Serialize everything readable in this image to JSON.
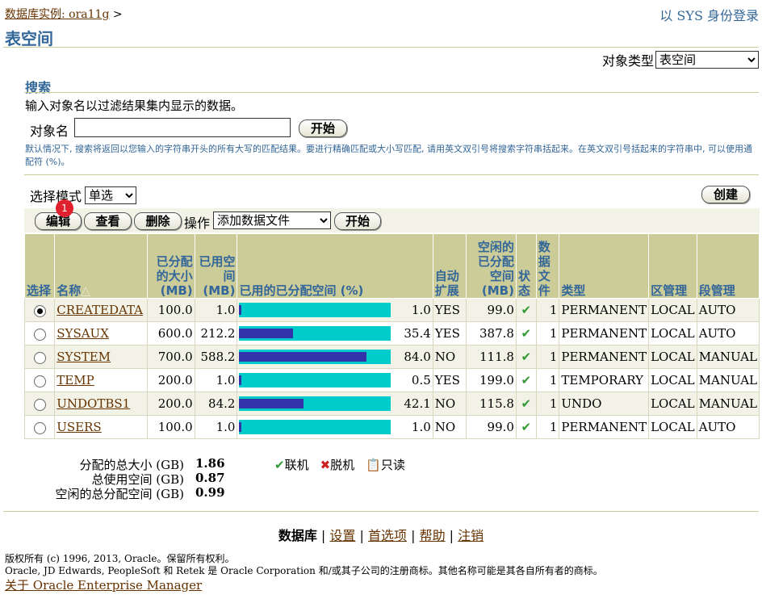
{
  "header": {
    "breadcrumb": "数据库实例: ora11g",
    "breadcrumb_sep": ">",
    "login": "以 SYS 身份登录",
    "title": "表空间"
  },
  "object_type": {
    "label": "对象类型",
    "value": "表空间"
  },
  "search": {
    "title": "搜索",
    "desc": "输入对象名以过滤结果集内显示的数据。",
    "object_label": "对象名",
    "input_value": "",
    "go": "开始",
    "hint": "默认情况下, 搜索将返回以您输入的字符串开头的所有大写的匹配结果。要进行精确匹配或大小写匹配, 请用英文双引号将搜索字符串括起来。在英文双引号括起来的字符串中, 可以使用通配符 (%)。"
  },
  "selection": {
    "label": "选择模式",
    "value": "单选",
    "create": "创建"
  },
  "actions": {
    "edit": "编辑",
    "view": "查看",
    "delete": "删除",
    "op_label": "操作",
    "op_value": "添加数据文件",
    "go": "开始",
    "badge": "1"
  },
  "columns": {
    "select": "选择",
    "name": "名称",
    "alloc_size": "已分配的大小(MB)",
    "used": "已用空间(MB)",
    "used_pct": "已用的已分配空间 (%)",
    "autoext": "自动扩展",
    "free": "空闲的已分配空间(MB)",
    "status": "状态",
    "datafiles": "数据文件",
    "type": "类型",
    "extent_mgmt": "区管理",
    "seg_mgmt": "段管理"
  },
  "rows": [
    {
      "name": "CREATEDATA",
      "size": "100.0",
      "used": "1.0",
      "pct": "1.0",
      "pct_val": 1.0,
      "auto": "YES",
      "free": "99.0",
      "files": "1",
      "type": "PERMANENT",
      "ext": "LOCAL",
      "seg": "AUTO"
    },
    {
      "name": "SYSAUX",
      "size": "600.0",
      "used": "212.2",
      "pct": "35.4",
      "pct_val": 35.4,
      "auto": "YES",
      "free": "387.8",
      "files": "1",
      "type": "PERMANENT",
      "ext": "LOCAL",
      "seg": "AUTO"
    },
    {
      "name": "SYSTEM",
      "size": "700.0",
      "used": "588.2",
      "pct": "84.0",
      "pct_val": 84.0,
      "auto": "NO",
      "free": "111.8",
      "files": "1",
      "type": "PERMANENT",
      "ext": "LOCAL",
      "seg": "MANUAL"
    },
    {
      "name": "TEMP",
      "size": "200.0",
      "used": "1.0",
      "pct": "0.5",
      "pct_val": 0.5,
      "auto": "YES",
      "free": "199.0",
      "files": "1",
      "type": "TEMPORARY",
      "ext": "LOCAL",
      "seg": "MANUAL"
    },
    {
      "name": "UNDOTBS1",
      "size": "200.0",
      "used": "84.2",
      "pct": "42.1",
      "pct_val": 42.1,
      "auto": "NO",
      "free": "115.8",
      "files": "1",
      "type": "UNDO",
      "ext": "LOCAL",
      "seg": "MANUAL"
    },
    {
      "name": "USERS",
      "size": "100.0",
      "used": "1.0",
      "pct": "1.0",
      "pct_val": 1.0,
      "auto": "NO",
      "free": "99.0",
      "files": "1",
      "type": "PERMANENT",
      "ext": "LOCAL",
      "seg": "AUTO"
    }
  ],
  "summary": {
    "total_label": "分配的总大小 (GB)",
    "total": "1.86",
    "used_label": "总使用空间 (GB)",
    "used": "0.87",
    "free_label": "空闲的总分配空间 (GB)",
    "free": "0.99"
  },
  "legend": {
    "online": "联机",
    "offline": "脱机",
    "readonly": "只读"
  },
  "footer": {
    "database": "数据库",
    "settings": "设置",
    "prefs": "首选项",
    "help": "帮助",
    "logout": "注销",
    "copy1": "版权所有 (c) 1996, 2013, Oracle。保留所有权利。",
    "copy2": "Oracle, JD Edwards, PeopleSoft 和 Retek 是 Oracle Corporation 和/或其子公司的注册商标。其他名称可能是其各自所有者的商标。",
    "about": "关于 Oracle Enterprise Manager"
  },
  "colors": {
    "header_blue": "#336699",
    "table_header": "#cccc99",
    "bar_cyan": "#00cccc",
    "bar_fill": "#3333aa",
    "link": "#663300"
  }
}
